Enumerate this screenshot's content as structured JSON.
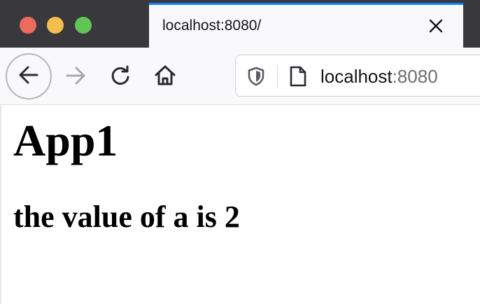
{
  "tab": {
    "title": "localhost:8080/"
  },
  "toolbar": {
    "url_host": "localhost",
    "url_port": ":8080"
  },
  "page": {
    "heading": "App1",
    "subheading": "the value of a is 2"
  },
  "icons": {
    "window_controls": [
      "close-window",
      "minimize-window",
      "maximize-window"
    ],
    "tab": [
      "close-icon"
    ],
    "navigation": [
      "back-arrow-icon",
      "forward-arrow-icon",
      "reload-icon",
      "home-icon"
    ],
    "urlbar": [
      "tracking-shield-icon",
      "page-icon"
    ]
  },
  "colors": {
    "tab_accent": "#0a84ff",
    "tabstrip_bg": "#38383d",
    "traffic_close": "#ed6a5e",
    "traffic_minimize": "#f5bf4f",
    "traffic_maximize": "#61c554"
  }
}
